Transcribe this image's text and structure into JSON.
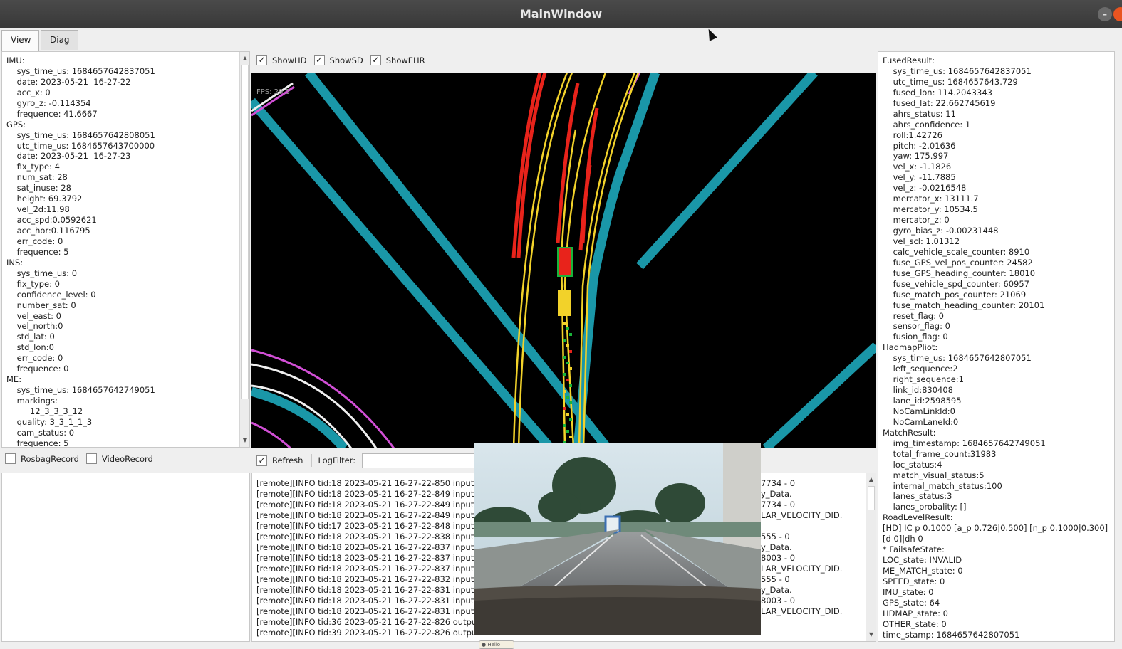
{
  "window": {
    "title": "MainWindow"
  },
  "tabs": [
    {
      "label": "View"
    },
    {
      "label": "Diag"
    }
  ],
  "left_panel": {
    "lines": [
      "IMU:",
      "    sys_time_us: 1684657642837051",
      "    date: 2023-05-21  16-27-22",
      "    acc_x: 0",
      "    gyro_z: -0.114354",
      "    frequence: 41.6667",
      "GPS:",
      "    sys_time_us: 1684657642808051",
      "    utc_time_us: 1684657643700000",
      "    date: 2023-05-21  16-27-23",
      "    fix_type: 4",
      "    num_sat: 28",
      "    sat_inuse: 28",
      "    height: 69.3792",
      "    vel_2d:11.98",
      "    acc_spd:0.0592621",
      "    acc_hor:0.116795",
      "    err_code: 0",
      "    frequence: 5",
      "INS:",
      "    sys_time_us: 0",
      "    fix_type: 0",
      "    confidence_level: 0",
      "    number_sat: 0",
      "    vel_east: 0",
      "    vel_north:0",
      "    std_lat: 0",
      "    std_lon:0",
      "    err_code: 0",
      "    frequence: 0",
      "ME:",
      "    sys_time_us: 1684657642749051",
      "    markings:",
      "         12_3_3_3_12",
      "    quality: 3_3_1_1_3",
      "    cam_status: 0",
      "    frequence: 5"
    ]
  },
  "record_options": [
    {
      "label": "RosbagRecord",
      "checked": false
    },
    {
      "label": "VideoRecord",
      "checked": false
    }
  ],
  "view_options": [
    {
      "label": "ShowHD",
      "checked": true
    },
    {
      "label": "ShowSD",
      "checked": true
    },
    {
      "label": "ShowEHR",
      "checked": true
    }
  ],
  "map": {
    "fps": "FPS: 29.3"
  },
  "log_controls": {
    "refresh_label": "Refresh",
    "refresh_checked": true,
    "filter_label": "LogFilter:",
    "filter_value": ""
  },
  "log_lines": [
    "[remote][INFO tid:18 2023-05-21 16-27-22-850 input_s",
    "[remote][INFO tid:18 2023-05-21 16-27-22-849 input_s",
    "[remote][INFO tid:18 2023-05-21 16-27-22-849 input_s",
    "[remote][INFO tid:18 2023-05-21 16-27-22-849 input_s",
    "[remote][INFO tid:17 2023-05-21 16-27-22-848 input_s",
    "[remote][INFO tid:18 2023-05-21 16-27-22-838 input_s",
    "[remote][INFO tid:18 2023-05-21 16-27-22-837 input_s",
    "[remote][INFO tid:18 2023-05-21 16-27-22-837 input_s",
    "[remote][INFO tid:18 2023-05-21 16-27-22-837 input_s",
    "[remote][INFO tid:18 2023-05-21 16-27-22-832 input_s",
    "[remote][INFO tid:18 2023-05-21 16-27-22-831 input_s",
    "[remote][INFO tid:18 2023-05-21 16-27-22-831 input_s",
    "[remote][INFO tid:18 2023-05-21 16-27-22-831 input_s",
    "[remote][INFO tid:36 2023-05-21 16-27-22-826 output",
    "[remote][INFO tid:39 2023-05-21 16-27-22-826 output"
  ],
  "log_right_fragments": [
    "7734 - 0",
    "y_Data.",
    "7734 - 0",
    "LAR_VELOCITY_DID.",
    "",
    "555 - 0",
    "y_Data.",
    "8003 - 0",
    "LAR_VELOCITY_DID.",
    "555 - 0",
    "y_Data.",
    "8003 - 0",
    "LAR_VELOCITY_DID.",
    "",
    ""
  ],
  "right_panel": {
    "lines": [
      "FusedResult:",
      "    sys_time_us: 1684657642837051",
      "    utc_time_us: 1684657643.729",
      "    fused_lon: 114.2043343",
      "    fused_lat: 22.662745619",
      "    ahrs_status: 11",
      "    ahrs_confidence: 1",
      "    roll:1.42726",
      "    pitch: -2.01636",
      "    yaw: 175.997",
      "    vel_x: -1.1826",
      "    vel_y: -11.7885",
      "    vel_z: -0.0216548",
      "    mercator_x: 13111.7",
      "    mercator_y: 10534.5",
      "    mercator_z: 0",
      "    gyro_bias_z: -0.00231448",
      "    vel_scl: 1.01312",
      "    calc_vehicle_scale_counter: 8910",
      "    fuse_GPS_vel_pos_counter: 24582",
      "    fuse_GPS_heading_counter: 18010",
      "    fuse_vehicle_spd_counter: 60957",
      "    fuse_match_pos_counter: 21069",
      "    fuse_match_heading_counter: 20101",
      "    reset_flag: 0",
      "    sensor_flag: 0",
      "    fusion_flag: 0",
      "HadmapPliot:",
      "    sys_time_us: 1684657642807051",
      "    left_sequence:2",
      "    right_sequence:1",
      "    link_id:830408",
      "    lane_id:2598595",
      "    NoCamLinkId:0",
      "    NoCamLaneId:0",
      "MatchResult:",
      "    img_timestamp: 1684657642749051",
      "    total_frame_count:31983",
      "    loc_status:4",
      "    match_visual_status:5",
      "    internal_match_status:100",
      "    lanes_status:3",
      "    lanes_probality: []",
      "RoadLevelResult:",
      "[HD] IC p 0.1000 [a_p 0.726|0.500] [n_p 0.1000|0.300]",
      "[d 0]|dh 0",
      "* FailsafeState:",
      "LOC_state: INVALID",
      "ME_MATCH_state: 0",
      "SPEED_state: 0",
      "IMU_state: 0",
      "GPS_state: 64",
      "HDMAP_state: 0",
      "OTHER_state: 0",
      "time_stamp: 1684657642807051"
    ]
  },
  "colors": {
    "lane_teal": "#1a97a8",
    "lane_red": "#e8231b",
    "lane_yellow": "#f2d22a",
    "lane_magenta": "#d24fd6",
    "lane_white": "#f0f0f0",
    "ego_green": "#19b43a",
    "title_bar": "#3d3d3d",
    "close_button": "#e95420"
  }
}
